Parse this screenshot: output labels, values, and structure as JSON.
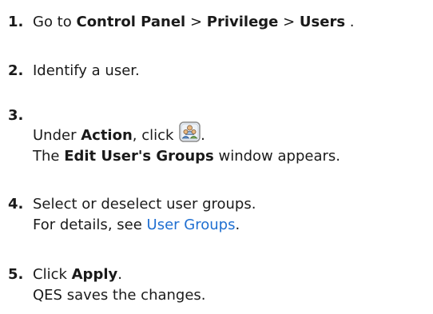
{
  "steps": [
    {
      "number": "1.",
      "line1": {
        "pre": "Go to ",
        "b1": "Control Panel",
        "sep1": " > ",
        "b2": "Privilege",
        "sep2": " > ",
        "b3": "Users",
        "post": " ."
      }
    },
    {
      "number": "2.",
      "text": "Identify a user."
    },
    {
      "number": "3.",
      "line1": {
        "pre": "Under ",
        "b1": "Action",
        "mid": ", click ",
        "post": "."
      },
      "icon": "edit-user-groups-icon",
      "line2": {
        "pre": "The ",
        "b1": "Edit User's Groups",
        "post": " window appears."
      }
    },
    {
      "number": "4.",
      "line1": "Select or deselect user groups.",
      "line2": {
        "pre": "For details, see ",
        "link": "User Groups",
        "post": "."
      }
    },
    {
      "number": "5.",
      "line1": {
        "pre": "Click ",
        "b1": "Apply",
        "post": "."
      },
      "line2": "QES saves the changes."
    }
  ],
  "colors": {
    "text": "#1a1a1a",
    "link": "#1f6fd1",
    "icon_frame": "#8c8c8c",
    "icon_fill": "#eef2f7"
  }
}
